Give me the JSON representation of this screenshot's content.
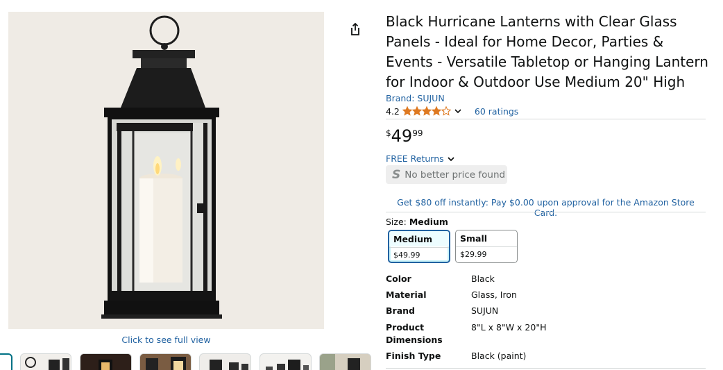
{
  "gallery": {
    "full_view_link": "Click to see full view",
    "thumbnail_count": 6
  },
  "share": {
    "icon": "share-icon"
  },
  "product": {
    "title": "Black Hurricane Lanterns with Clear Glass Panels - Ideal for Home Decor, Parties & Events - Versatile Tabletop or Hanging Lantern for Indoor & Outdoor Use Medium 20\" High",
    "brand_link": "Brand: SUJUN",
    "rating": "4.2",
    "rating_fraction": 0.84,
    "star_color": "#de7921",
    "ratings_link": "60 ratings",
    "price": {
      "symbol": "$",
      "whole": "49",
      "fraction": "99"
    },
    "returns": "FREE Returns",
    "no_better_price": "No better price found",
    "promo": "Get $80 off instantly: Pay $0.00 upon approval for the Amazon Store Card."
  },
  "size": {
    "label": "Size:",
    "selected": "Medium",
    "options": [
      {
        "name": "Medium",
        "price": "$49.99"
      },
      {
        "name": "Small",
        "price": "$29.99"
      }
    ]
  },
  "specs": [
    {
      "key": "Color",
      "value": "Black"
    },
    {
      "key": "Material",
      "value": "Glass, Iron"
    },
    {
      "key": "Brand",
      "value": "SUJUN"
    },
    {
      "key": "Product Dimensions",
      "value": "8\"L x 8\"W x 20\"H"
    },
    {
      "key": "Finish Type",
      "value": "Black (paint)"
    }
  ],
  "colors": {
    "link": "#2162a1",
    "accent_selected": "#2162a1"
  }
}
